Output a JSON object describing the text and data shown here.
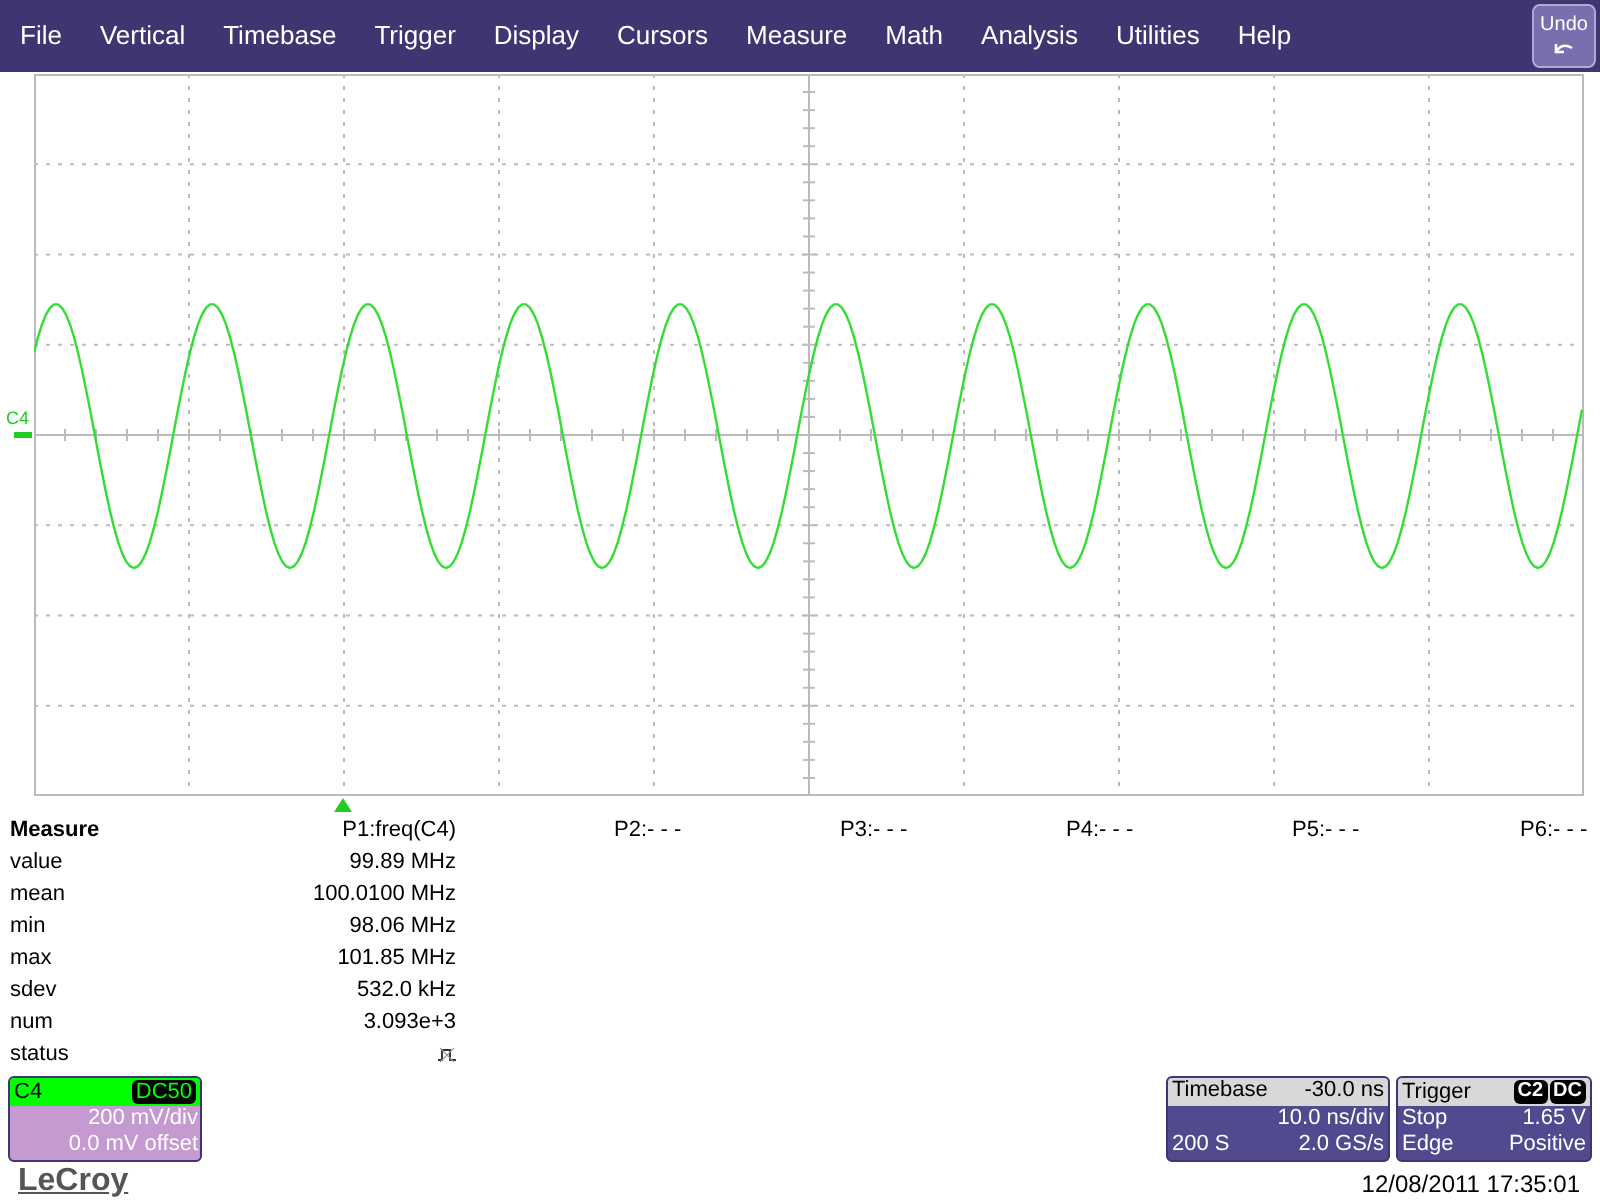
{
  "menu": {
    "items": [
      "File",
      "Vertical",
      "Timebase",
      "Trigger",
      "Display",
      "Cursors",
      "Measure",
      "Math",
      "Analysis",
      "Utilities",
      "Help"
    ],
    "undo": "Undo"
  },
  "scope": {
    "channel_label": "C4"
  },
  "measure": {
    "title": "Measure",
    "parameters": [
      "P1:freq(C4)",
      "P2:- - -",
      "P3:- - -",
      "P4:- - -",
      "P5:- - -",
      "P6:- - -"
    ],
    "rows": [
      {
        "label": "value",
        "value": "99.89 MHz"
      },
      {
        "label": "mean",
        "value": "100.0100 MHz"
      },
      {
        "label": "min",
        "value": "98.06 MHz"
      },
      {
        "label": "max",
        "value": "101.85 MHz"
      },
      {
        "label": "sdev",
        "value": "532.0 kHz"
      },
      {
        "label": "num",
        "value": "3.093e+3"
      },
      {
        "label": "status"
      }
    ]
  },
  "channel": {
    "name": "C4",
    "coupling": "DC50",
    "scale": "200 mV/div",
    "offset": "0.0 mV offset"
  },
  "timebase": {
    "title": "Timebase",
    "delay": "-30.0 ns",
    "scale": "10.0 ns/div",
    "samples": "200 S",
    "rate": "2.0 GS/s"
  },
  "trigger": {
    "title": "Trigger",
    "source": "C2",
    "coupling": "DC",
    "mode": "Stop",
    "trigger_level": "1.65 V",
    "type": "Edge",
    "slope": "Positive"
  },
  "logo": "LeCroy",
  "datetime": "12/08/2011 17:35:01"
}
